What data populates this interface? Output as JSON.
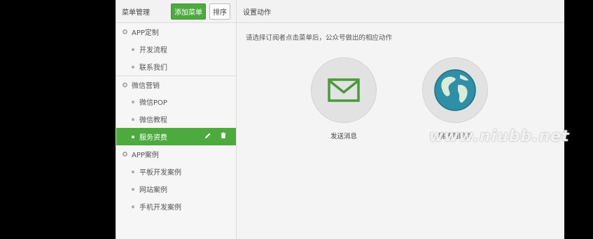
{
  "sidebar": {
    "title": "菜单管理",
    "add_button": "添加菜单",
    "sort_button": "排序",
    "items": [
      {
        "label": "APP定制",
        "level": "parent"
      },
      {
        "label": "开发流程",
        "level": "child"
      },
      {
        "label": "联系我们",
        "level": "child"
      },
      {
        "label": "微信营销",
        "level": "parent"
      },
      {
        "label": "微信POP",
        "level": "child"
      },
      {
        "label": "微信教程",
        "level": "child"
      },
      {
        "label": "服务资费",
        "level": "child",
        "active": true
      },
      {
        "label": "APP案例",
        "level": "parent"
      },
      {
        "label": "平板开发案例",
        "level": "child"
      },
      {
        "label": "网站案例",
        "level": "child"
      },
      {
        "label": "手机开发案例",
        "level": "child"
      }
    ],
    "edit_icon": "pencil-icon",
    "delete_icon": "trash-icon"
  },
  "main": {
    "title": "设置动作",
    "description": "请选择订阅者点击菜单后，公众号做出的相应动作",
    "actions": [
      {
        "label": "发送消息",
        "icon": "envelope-icon"
      },
      {
        "label": "跳转到网页",
        "icon": "globe-icon"
      }
    ]
  },
  "watermark": "www.niubb.net",
  "colors": {
    "accent": "#4caa3f",
    "background": "#000000"
  }
}
